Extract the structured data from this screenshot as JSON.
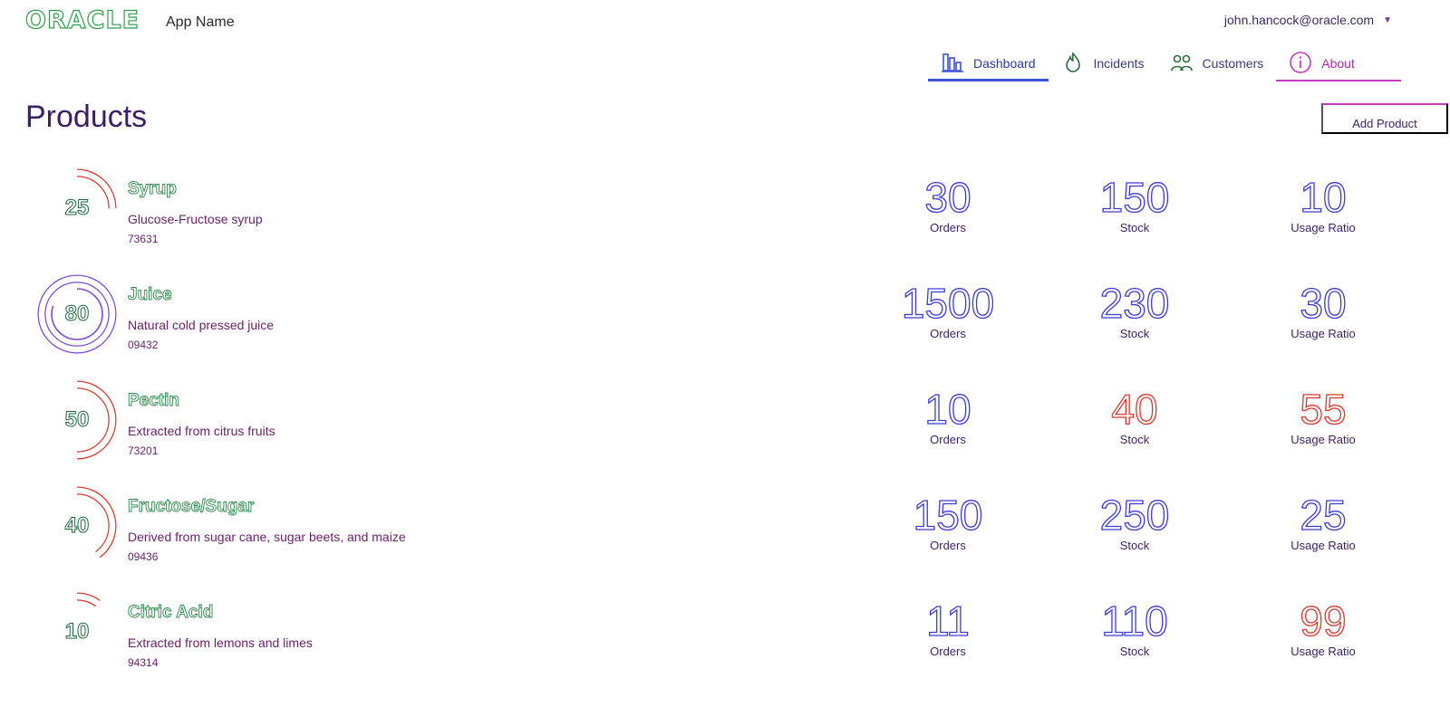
{
  "header": {
    "logo_text": "ORACLE",
    "app_name": "App Name",
    "user_email": "john.hancock@oracle.com"
  },
  "nav": {
    "tabs": [
      {
        "label": "Dashboard",
        "icon": "bar-chart-icon",
        "active": true
      },
      {
        "label": "Incidents",
        "icon": "fire-icon"
      },
      {
        "label": "Customers",
        "icon": "people-icon"
      },
      {
        "label": "About",
        "icon": "info-icon"
      }
    ]
  },
  "page": {
    "title": "Products",
    "add_product_label": "Add Product"
  },
  "colors": {
    "accent": "#3b4fd8",
    "warning": "#d8382a",
    "gauge_full": "#7a4ad8",
    "gauge_partial": "#d8382a"
  },
  "metric_labels": {
    "orders": "Orders",
    "stock": "Stock",
    "ratio": "Usage Ratio"
  },
  "products": [
    {
      "gauge": "25",
      "gauge_fraction": 0.25,
      "name": "Syrup",
      "description": "Glucose-Fructose syrup",
      "code": "73631",
      "orders": "30",
      "stock": "150",
      "ratio": "10",
      "stock_warn": false,
      "ratio_warn": false
    },
    {
      "gauge": "80",
      "gauge_fraction": 0.8,
      "name": "Juice",
      "description": "Natural cold pressed juice",
      "code": "09432",
      "orders": "1500",
      "stock": "230",
      "ratio": "30",
      "stock_warn": false,
      "ratio_warn": false
    },
    {
      "gauge": "50",
      "gauge_fraction": 0.5,
      "name": "Pectin",
      "description": "Extracted from citrus fruits",
      "code": "73201",
      "orders": "10",
      "stock": "40",
      "ratio": "55",
      "stock_warn": true,
      "ratio_warn": true
    },
    {
      "gauge": "40",
      "gauge_fraction": 0.4,
      "name": "Fructose/Sugar",
      "description": "Derived from sugar cane, sugar beets, and maize",
      "code": "09436",
      "orders": "150",
      "stock": "250",
      "ratio": "25",
      "stock_warn": false,
      "ratio_warn": false
    },
    {
      "gauge": "10",
      "gauge_fraction": 0.1,
      "name": "Citric Acid",
      "description": "Extracted from lemons and limes",
      "code": "94314",
      "orders": "11",
      "stock": "110",
      "ratio": "99",
      "stock_warn": false,
      "ratio_warn": true
    }
  ]
}
